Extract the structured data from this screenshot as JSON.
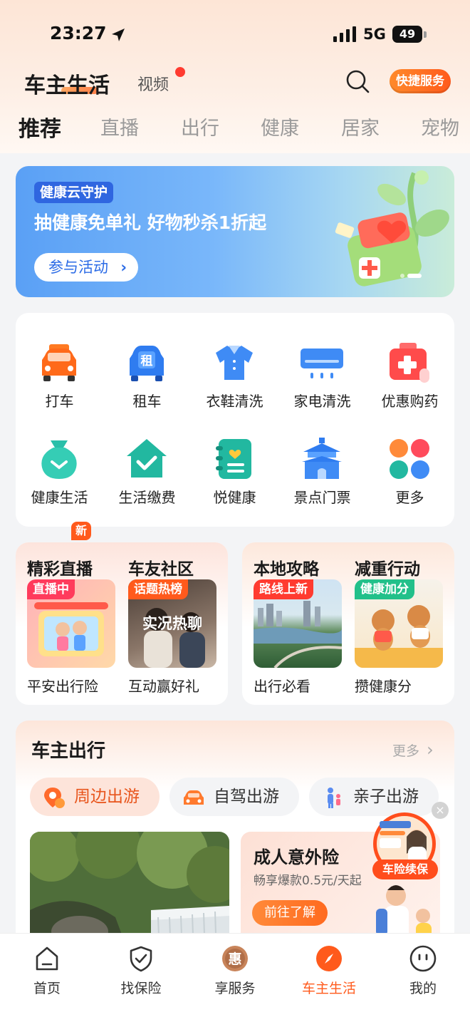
{
  "status_bar": {
    "time": "23:27",
    "network": "5G",
    "battery": "49"
  },
  "header": {
    "title": "车主生活",
    "video_tab": "视频",
    "quick_service": "快捷服务",
    "categories": [
      "推荐",
      "直播",
      "出行",
      "健康",
      "居家",
      "宠物"
    ]
  },
  "banner": {
    "tag": "健康云守护",
    "headline": "抽健康免单礼 好物秒杀1折起",
    "button": "参与活动"
  },
  "services": [
    {
      "label": "打车",
      "icon": "taxi-icon"
    },
    {
      "label": "租车",
      "icon": "rent-car-icon"
    },
    {
      "label": "衣鞋清洗",
      "icon": "shirt-icon"
    },
    {
      "label": "家电清洗",
      "icon": "air-conditioner-icon"
    },
    {
      "label": "优惠购药",
      "icon": "medicine-kit-icon"
    },
    {
      "label": "健康生活",
      "icon": "money-bag-icon",
      "badge": "新"
    },
    {
      "label": "生活缴费",
      "icon": "home-check-icon"
    },
    {
      "label": "悦健康",
      "icon": "notebook-heart-icon"
    },
    {
      "label": "景点门票",
      "icon": "pagoda-icon"
    },
    {
      "label": "更多",
      "icon": "more-dots-icon"
    }
  ],
  "feature_cards": {
    "left": {
      "items": [
        {
          "title": "精彩直播",
          "tag": "直播中",
          "caption": "平安出行险"
        },
        {
          "title": "车友社区",
          "tag": "话题热榜",
          "overlay": "实况热聊",
          "caption": "互动赢好礼"
        }
      ]
    },
    "right": {
      "items": [
        {
          "title": "本地攻略",
          "tag": "路线上新",
          "caption": "出行必看"
        },
        {
          "title": "减重行动",
          "tag": "健康加分",
          "caption": "攒健康分"
        }
      ]
    }
  },
  "travel": {
    "title": "车主出行",
    "more": "更多",
    "chips": [
      {
        "label": "周边出游",
        "icon": "map-pin-icon",
        "active": true
      },
      {
        "label": "自驾出游",
        "icon": "car-icon",
        "active": false
      },
      {
        "label": "亲子出游",
        "icon": "family-icon",
        "active": false
      }
    ],
    "insurance_card": {
      "title": "成人意外险",
      "subtitle": "畅享爆款0.5元/天起",
      "button": "前往了解"
    },
    "float_ad": {
      "label": "车险续保"
    }
  },
  "bottom_nav": [
    {
      "label": "首页",
      "icon": "home-icon",
      "active": false
    },
    {
      "label": "找保险",
      "icon": "shield-check-icon",
      "active": false
    },
    {
      "label": "享服务",
      "icon": "hui-badge-icon",
      "badge_text": "惠",
      "active": false
    },
    {
      "label": "车主生活",
      "icon": "compass-icon",
      "active": true
    },
    {
      "label": "我的",
      "icon": "smiley-icon",
      "active": false
    }
  ],
  "colors": {
    "accent": "#ff5a1c",
    "banner_blue": "#5aa0f5",
    "text_dark": "#1a1a1a"
  }
}
